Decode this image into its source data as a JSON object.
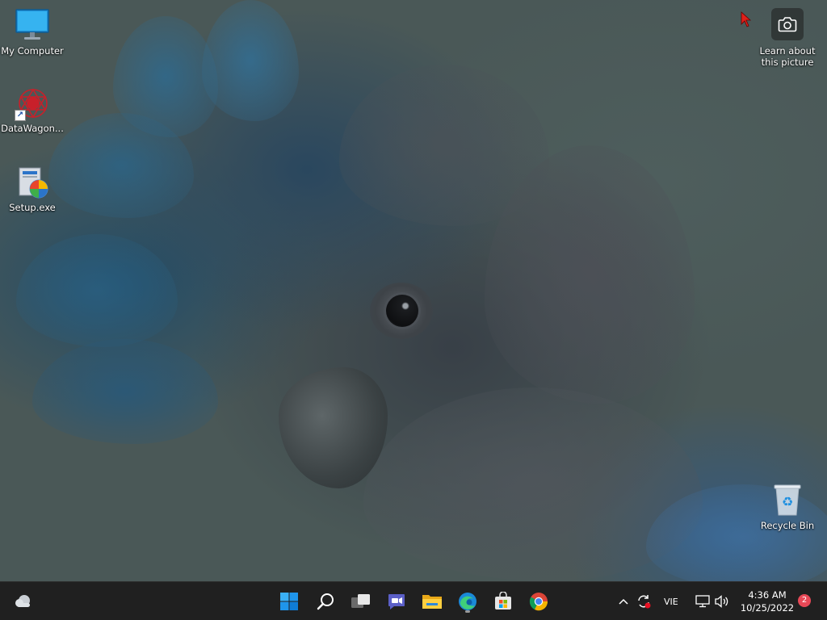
{
  "desktop": {
    "icons": [
      {
        "label": "My Computer",
        "icon": "monitor-icon"
      },
      {
        "label": "DataWagon...",
        "icon": "datawagon-icon"
      },
      {
        "label": "Setup.exe",
        "icon": "installer-icon"
      },
      {
        "label": "Recycle Bin",
        "icon": "recycle-bin-icon"
      }
    ],
    "spotlight": {
      "line1": "Learn about",
      "line2": "this picture",
      "icon": "camera-icon"
    }
  },
  "taskbar": {
    "pinned": [
      {
        "name": "Start",
        "icon": "windows-start-icon"
      },
      {
        "name": "Search",
        "icon": "search-icon"
      },
      {
        "name": "Task View",
        "icon": "task-view-icon"
      },
      {
        "name": "Chat",
        "icon": "chat-icon"
      },
      {
        "name": "File Explorer",
        "icon": "folder-icon"
      },
      {
        "name": "Microsoft Edge",
        "icon": "edge-icon"
      },
      {
        "name": "Microsoft Store",
        "icon": "store-icon"
      },
      {
        "name": "Google Chrome",
        "icon": "chrome-icon"
      }
    ],
    "tray": {
      "language": "VIE",
      "time": "4:36 AM",
      "date": "10/25/2022",
      "notification_count": "2"
    }
  },
  "colors": {
    "taskbar_bg": "#202020",
    "accent_blue": "#0078d4",
    "badge_red": "#e74856",
    "cursor_red": "#e0201a"
  }
}
